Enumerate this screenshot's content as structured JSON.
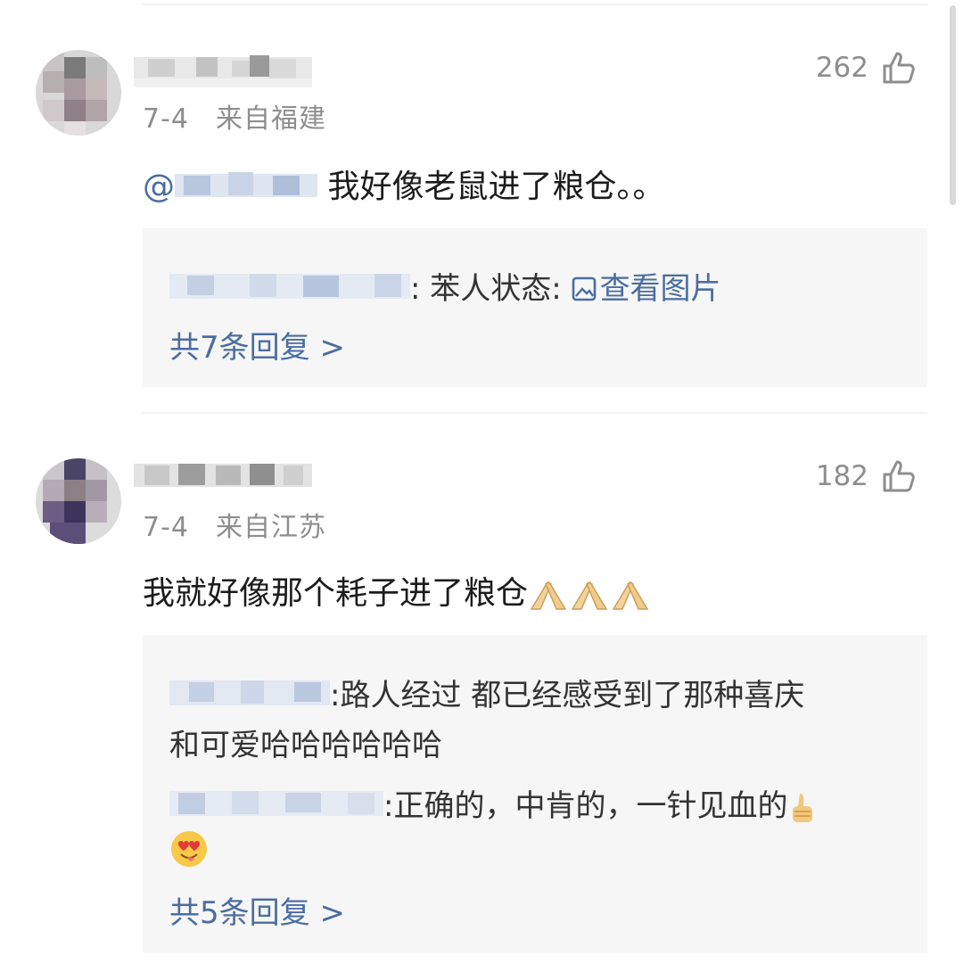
{
  "comments": [
    {
      "date": "7-4",
      "location": "来自福建",
      "likes": "262",
      "mention_prefix": "@",
      "text": "我好像老鼠进了粮仓。。",
      "replies": [
        {
          "sep": ":",
          "text": "苯人状态:",
          "link_label": "查看图片"
        }
      ],
      "more_replies": "共7条回复 >"
    },
    {
      "date": "7-4",
      "location": "来自江苏",
      "likes": "182",
      "text": "我就好像那个耗子进了粮仓",
      "replies": [
        {
          "sep": ":",
          "text": "路人经过 都已经感受到了那种喜庆",
          "text2": "和可爱哈哈哈哈哈哈"
        },
        {
          "sep": ":",
          "text": "正确的，中肯的，一针见血的"
        }
      ],
      "more_replies": "共5条回复 >"
    }
  ],
  "icons": {
    "like": "thumbs-up-outline-icon",
    "image": "image-icon",
    "folded_hands": "folded-hands-emoji-icon",
    "thumbs_up_emoji": "thumbs-up-emoji-icon",
    "heart_eyes": "heart-eyes-tongue-emoji-icon"
  },
  "colors": {
    "link": "#4a6da1",
    "meta": "#8e8e8e",
    "reply_bg": "#f6f6f6"
  }
}
